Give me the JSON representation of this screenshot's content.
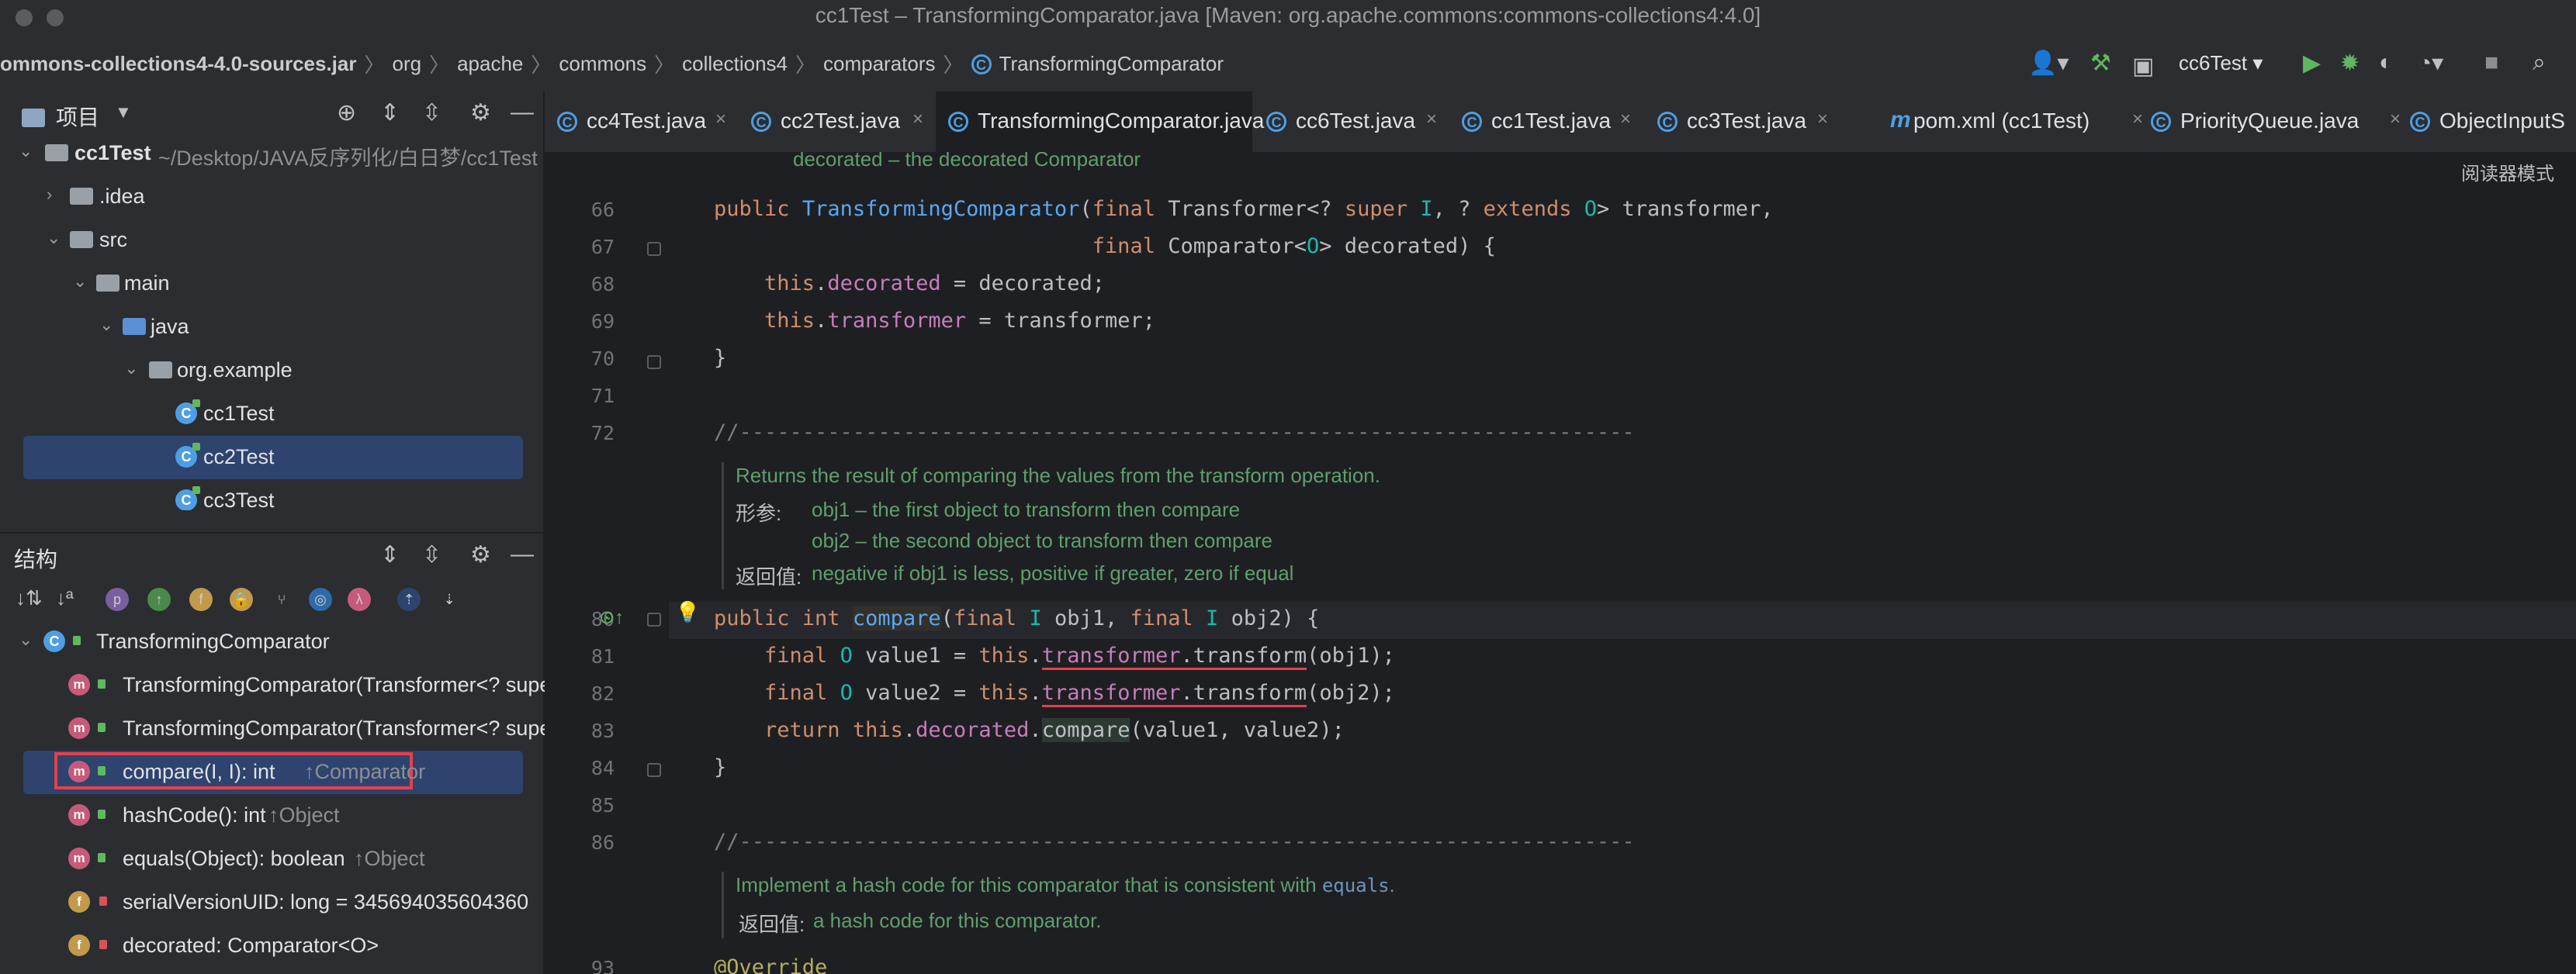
{
  "window": {
    "title": "cc1Test – TransformingComparator.java [Maven: org.apache.commons:commons-collections4:4.0]"
  },
  "breadcrumbs": [
    "ommons-collections4-4.0-sources.jar",
    "org",
    "apache",
    "commons",
    "collections4",
    "comparators",
    "TransformingComparator"
  ],
  "toolbar": {
    "run_config": "cc6Test"
  },
  "project_panel": {
    "title": "项目",
    "root_name": "cc1Test",
    "root_path": "~/Desktop/JAVA反序列化/白日梦/cc1Test",
    "items": [
      {
        "label": ".idea"
      },
      {
        "label": "src"
      },
      {
        "label": "main"
      },
      {
        "label": "java"
      },
      {
        "label": "org.example"
      },
      {
        "label": "cc1Test"
      },
      {
        "label": "cc2Test"
      },
      {
        "label": "cc3Test"
      }
    ]
  },
  "structure_panel": {
    "title": "结构",
    "class_name": "TransformingComparator",
    "members": [
      {
        "label": "TransformingComparator(Transformer<? supe",
        "suffix": ""
      },
      {
        "label": "TransformingComparator(Transformer<? supe",
        "suffix": ""
      },
      {
        "label": "compare(I, I): int",
        "suffix": "↑Comparator"
      },
      {
        "label": "hashCode(): int",
        "suffix": "↑Object"
      },
      {
        "label": "equals(Object): boolean",
        "suffix": "↑Object"
      },
      {
        "label": "serialVersionUID: long = 345694035604360",
        "suffix": ""
      },
      {
        "label": "decorated: Comparator<O>",
        "suffix": ""
      }
    ]
  },
  "tabs": [
    {
      "label": "cc4Test.java"
    },
    {
      "label": "cc2Test.java"
    },
    {
      "label": "TransformingComparator.java"
    },
    {
      "label": "cc6Test.java"
    },
    {
      "label": "cc1Test.java"
    },
    {
      "label": "cc3Test.java"
    },
    {
      "label": "pom.xml (cc1Test)"
    },
    {
      "label": "PriorityQueue.java"
    },
    {
      "label": "ObjectInputS"
    }
  ],
  "editor": {
    "reader_mode": "阅读器模式",
    "top_doc": "decorated – the decorated Comparator",
    "line_numbers": [
      "66",
      "67",
      "68",
      "69",
      "70",
      "71",
      "72",
      "80",
      "81",
      "82",
      "83",
      "84",
      "85",
      "86",
      "93"
    ],
    "doc_compare": {
      "desc": "Returns the result of comparing the values from the transform operation.",
      "params_label": "形参:",
      "param1": "obj1 – the first object to transform then compare",
      "param2": "obj2 – the second object to transform then compare",
      "return_label": "返回值:",
      "return_text": "negative if obj1 is less, positive if greater, zero if equal"
    },
    "doc_hash": {
      "desc": "Implement a hash code for this comparator that is consistent with",
      "desc_code": "equals",
      "desc_end": ".",
      "return_label": "返回值:",
      "return_text": "a hash code for this comparator."
    },
    "separator": "//-----------------------------------------------------------------------",
    "override": "@Override"
  }
}
